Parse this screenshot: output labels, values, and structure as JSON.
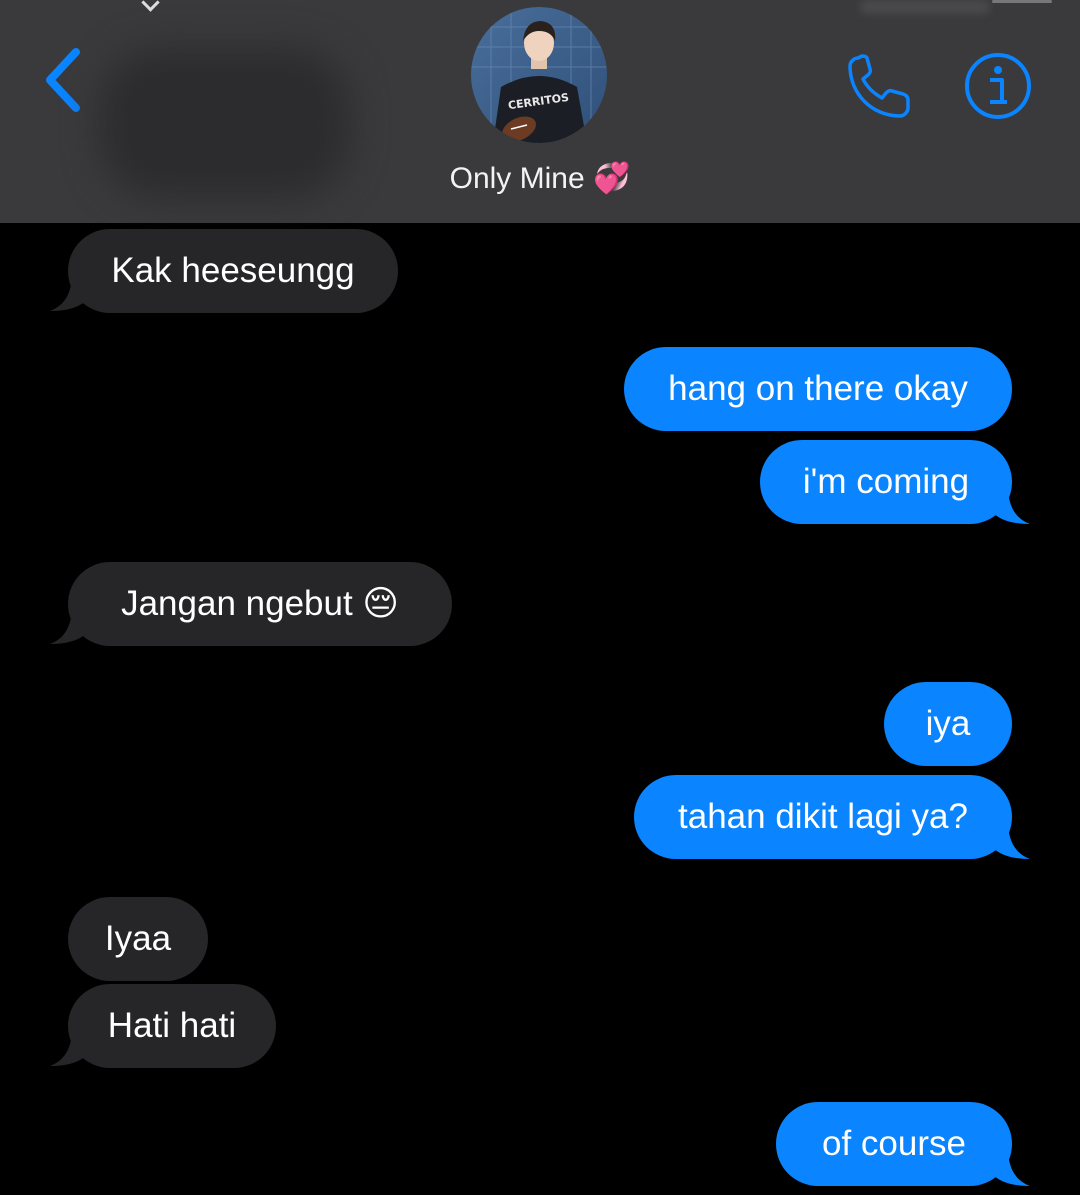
{
  "header": {
    "contact_name": "Only Mine 💞",
    "back_icon": "chevron-left-icon",
    "call_icon": "phone-icon",
    "info_icon": "info-icon",
    "accent_color": "#0a84ff"
  },
  "messages": [
    {
      "direction": "incoming",
      "text": "Kak heeseungg"
    },
    {
      "direction": "outgoing",
      "text": "hang on there okay"
    },
    {
      "direction": "outgoing",
      "text": "i'm coming"
    },
    {
      "direction": "incoming",
      "text": "Jangan ngebut 😔"
    },
    {
      "direction": "outgoing",
      "text": "iya"
    },
    {
      "direction": "outgoing",
      "text": "tahan dikit lagi ya?"
    },
    {
      "direction": "incoming",
      "text": "Iyaa"
    },
    {
      "direction": "incoming",
      "text": "Hati hati"
    },
    {
      "direction": "outgoing",
      "text": "of course"
    }
  ],
  "colors": {
    "incoming_bubble": "#262628",
    "outgoing_bubble": "#0a84ff",
    "header_bg": "#3a3a3c",
    "background": "#000000"
  }
}
